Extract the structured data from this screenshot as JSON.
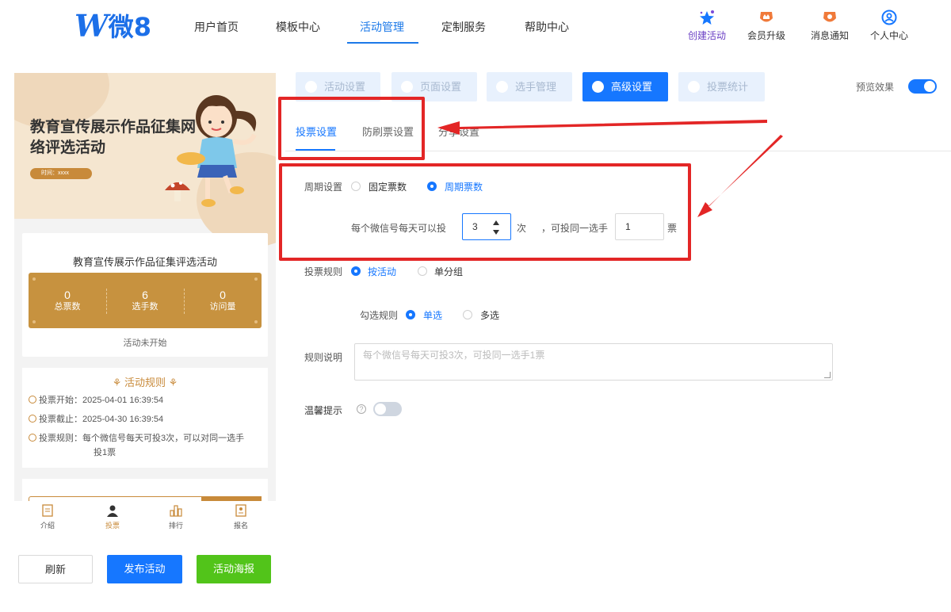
{
  "brand": {
    "logo_text": "微8",
    "primary": "#1677ff",
    "accent_gold": "#c7923f",
    "annotation_red": "#e32626"
  },
  "nav": {
    "items": [
      "用户首页",
      "模板中心",
      "活动管理",
      "定制服务",
      "帮助中心"
    ],
    "active": "活动管理",
    "actions": [
      {
        "label": "创建活动",
        "icon": "sparkle-star-icon"
      },
      {
        "label": "会员升级",
        "icon": "crown-badge-icon"
      },
      {
        "label": "消息通知",
        "icon": "bell-badge-icon"
      },
      {
        "label": "个人中心",
        "icon": "user-circle-icon"
      }
    ]
  },
  "preview": {
    "banner_title": "教育宣传展示作品征集网络评选活动",
    "banner_time": "时间：xxxx",
    "activity_title": "教育宣传展示作品征集评选活动",
    "stats": [
      {
        "value": "0",
        "label": "总票数"
      },
      {
        "value": "6",
        "label": "选手数"
      },
      {
        "value": "0",
        "label": "访问量"
      }
    ],
    "status": "活动未开始",
    "rules_title": "活动规则",
    "rules": [
      {
        "label": "投票开始：",
        "value": "2025-04-01 16:39:54"
      },
      {
        "label": "投票截止：",
        "value": "2025-04-30 16:39:54"
      },
      {
        "label": "投票规则：",
        "value": "每个微信号每天可投3次，可以对同一选手",
        "value2": "投1票"
      }
    ],
    "bottom_tabs": [
      {
        "label": "介绍",
        "icon": "document-icon"
      },
      {
        "label": "投票",
        "icon": "user-icon"
      },
      {
        "label": "排行",
        "icon": "ranking-bars-icon"
      },
      {
        "label": "报名",
        "icon": "signup-form-icon"
      }
    ]
  },
  "actions": {
    "refresh": "刷新",
    "publish": "发布活动",
    "poster": "活动海报"
  },
  "steps": [
    "活动设置",
    "页面设置",
    "选手管理",
    "高级设置",
    "投票统计"
  ],
  "steps_active": "高级设置",
  "preview_toggle": {
    "label": "预览效果",
    "on": true
  },
  "sub_tabs": [
    "投票设置",
    "防刷票设置",
    "分享设置"
  ],
  "sub_tabs_active": "投票设置",
  "form": {
    "period": {
      "label": "周期设置",
      "options": [
        "固定票数",
        "周期票数"
      ],
      "selected": "周期票数"
    },
    "per_day": {
      "prefix": "每个微信号每天可以投",
      "value": "3",
      "unit": "次",
      "mid": "，可投同一选手",
      "value2": "1",
      "unit2": "票"
    },
    "vote_rule": {
      "label": "投票规则",
      "options": [
        "按活动",
        "单分组"
      ],
      "selected": "按活动"
    },
    "check_rule": {
      "label": "勾选规则",
      "options": [
        "单选",
        "多选"
      ],
      "selected": "单选"
    },
    "description": {
      "label": "规则说明",
      "placeholder": "每个微信号每天可投3次，可投同一选手1票"
    },
    "tip": {
      "label": "温馨提示",
      "on": false
    }
  }
}
